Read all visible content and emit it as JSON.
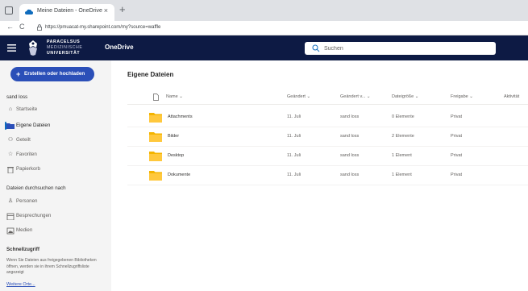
{
  "browser": {
    "tab_title": "Meine Dateien - OneDrive",
    "tab_close": "×",
    "new_tab": "+",
    "url": "https://pmuacat-my.sharepoint.com/my?source=waffle",
    "nav_back": "←",
    "nav_reload": "C"
  },
  "suite": {
    "org_line1": "PARACELSUS",
    "org_line2": "MEDIZINISCHE",
    "org_line3": "UNIVERSITÄT",
    "app_name": "OneDrive",
    "search_placeholder": "Suchen"
  },
  "leftnav": {
    "create_label": "Erstellen oder hochladen",
    "create_plus": "+",
    "user": "sand loss",
    "items": [
      {
        "label": "Startseite",
        "icon": "home-icon"
      },
      {
        "label": "Eigene Dateien",
        "icon": "folder-icon"
      },
      {
        "label": "Geteilt",
        "icon": "people-icon"
      },
      {
        "label": "Favoriten",
        "icon": "star-icon"
      },
      {
        "label": "Papierkorb",
        "icon": "trash-icon"
      }
    ],
    "browse_title": "Dateien durchsuchen nach",
    "browse_items": [
      {
        "label": "Personen",
        "icon": "person-icon"
      },
      {
        "label": "Besprechungen",
        "icon": "calendar-icon"
      },
      {
        "label": "Medien",
        "icon": "image-icon"
      }
    ],
    "quick_title": "Schnellzugriff",
    "quick_desc": "Wenn Sie Dateien aus freigegebenen Bibliotheken öffnen, werden sie in ihrem Schnellzugriffsliste angezeigt",
    "quick_link": "Weitere Orte..."
  },
  "main": {
    "title": "Eigene Dateien",
    "columns": [
      "Name",
      "Geändert",
      "Geändert v...",
      "Dateigröße",
      "Freigabe",
      "Aktivität"
    ],
    "sort_glyph": "⌄",
    "rows": [
      {
        "name": "Attachments",
        "modified": "11. Juli",
        "modified_by": "sand loss",
        "size": "0 Elemente",
        "sharing": "Privat"
      },
      {
        "name": "Bilder",
        "modified": "11. Juli",
        "modified_by": "sand loss",
        "size": "2 Elemente",
        "sharing": "Privat"
      },
      {
        "name": "Desktop",
        "modified": "11. Juli",
        "modified_by": "sand loss",
        "size": "1 Element",
        "sharing": "Privat"
      },
      {
        "name": "Dokumente",
        "modified": "11. Juli",
        "modified_by": "sand loss",
        "size": "1 Element",
        "sharing": "Privat"
      }
    ]
  },
  "colors": {
    "suite_bar": "#0d1a44",
    "create_button": "#2b4fb8",
    "folder": "#f4b400",
    "active_indicator": "#0f6cbd"
  }
}
